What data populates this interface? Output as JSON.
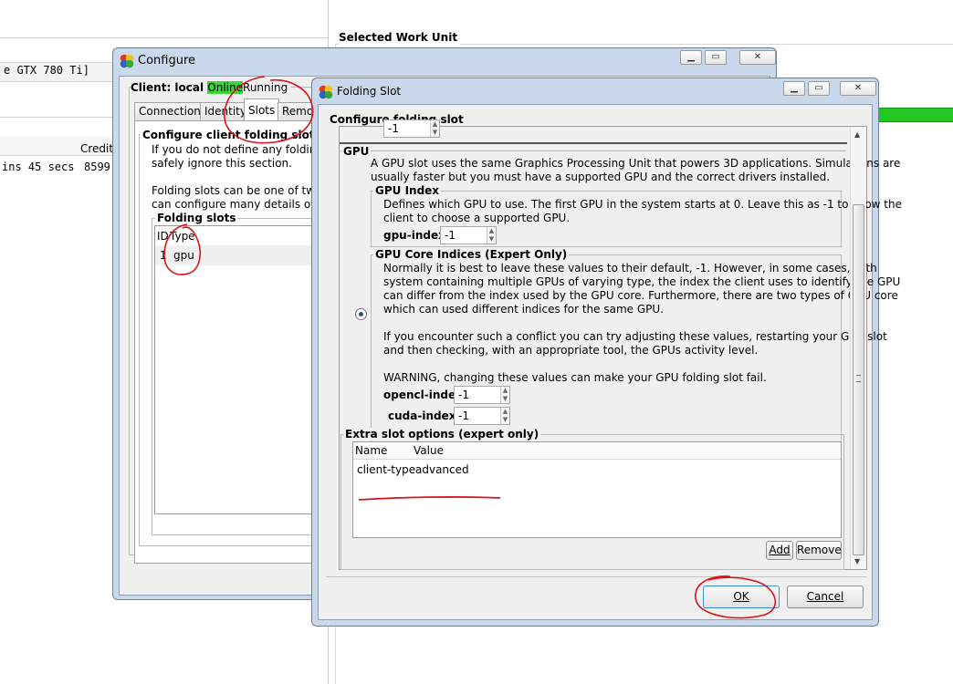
{
  "background": {
    "gpu_name": "e GTX 780 Ti]",
    "credit_header": "Credit",
    "eta_text": "ins 45 secs",
    "credit_value": "8599",
    "selected_work_unit": "Selected Work Unit"
  },
  "configure": {
    "title": "Configure",
    "client_prefix": "Client: local",
    "status_online": "Online",
    "status_running": "Running",
    "tabs": [
      "Connection",
      "Identity",
      "Slots",
      "Remo"
    ],
    "slots_group_title": "Configure client folding slots",
    "slots_desc_1": "If you do not define any folding sl",
    "slots_desc_2": "safely ignore this section.",
    "slots_desc_3": "Folding slots can be one of two ty",
    "slots_desc_4": "can configure many details of eac",
    "folding_slots_title": "Folding slots",
    "col_id": "ID",
    "col_type": "Type",
    "row_id": "1",
    "row_type": "gpu"
  },
  "slot": {
    "title": "Folding Slot",
    "header": "Configure folding slot",
    "top_value": "-1",
    "gpu_title": "GPU",
    "gpu_desc_1": "A GPU slot uses the same Graphics Processing Unit that powers 3D applications.  Simulations are",
    "gpu_desc_2": "usually faster but you must have a supported GPU and the correct drivers installed.",
    "gpu_index_title": "GPU Index",
    "gpu_index_desc_1": "Defines which GPU to use.  The first GPU in the system starts at 0.  Leave this as -1 to allow the",
    "gpu_index_desc_2": "client to choose a supported GPU.",
    "gpu_index_label": "gpu-index",
    "gpu_index_value": "-1",
    "core_title": "GPU Core Indices (Expert Only)",
    "core_desc_1": "Normally it is best to leave these values to their default, -1.  However, in some cases, with",
    "core_desc_2": "system containing multiple GPUs of varying type, the index the client uses to identify the GPU",
    "core_desc_3": "can differ from the index used by the GPU core.  Furthermore, there are two types of GPU core",
    "core_desc_4": "which can used different indices for the same GPU.",
    "core_desc_5": "If you encounter such a conflict you can try adjusting these values, restarting your GPU slot",
    "core_desc_6": "and then checking, with an appropriate tool, the GPUs activity level.",
    "core_warning": "WARNING, changing these values can make your GPU folding slot fail.",
    "opencl_label": "opencl-index",
    "opencl_value": "-1",
    "cuda_label": "cuda-index",
    "cuda_value": "-1",
    "extra_title": "Extra slot options (expert only)",
    "col_name": "Name",
    "col_value": "Value",
    "option_name": "client-type",
    "option_value": "advanced",
    "add_label": "Add",
    "remove_label": "Remove",
    "ok_label": "OK",
    "cancel_label": "Cancel"
  },
  "annotation_color": "#d8141c",
  "online_color": "#3cd33c",
  "progress_color": "#22c922"
}
